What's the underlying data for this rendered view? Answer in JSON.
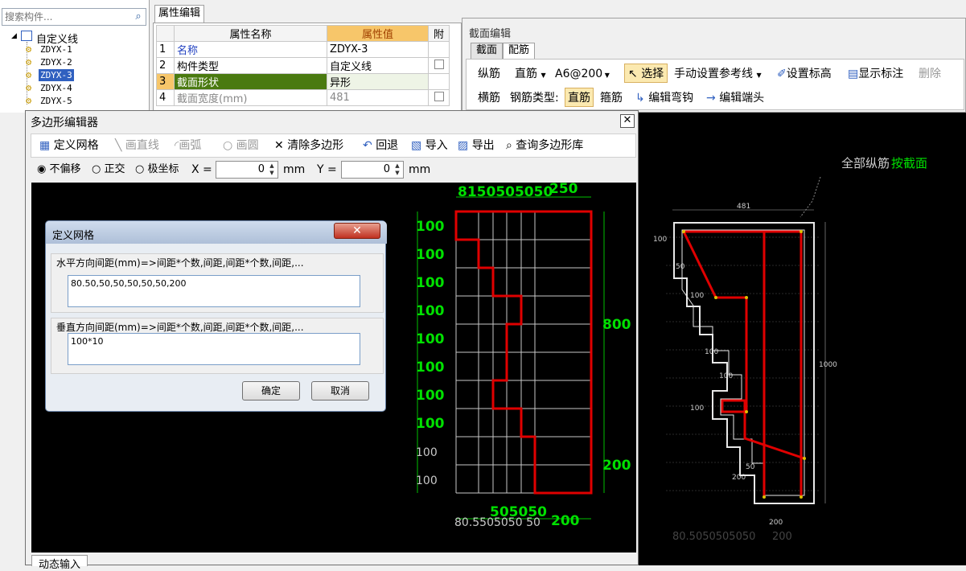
{
  "tree": {
    "search_placeholder": "搜索构件...",
    "root_label": "自定义线",
    "items": [
      "ZDYX-1",
      "ZDYX-2",
      "ZDYX-3",
      "ZDYX-4",
      "ZDYX-5"
    ]
  },
  "props": {
    "tab": "属性编辑",
    "headers": {
      "name": "属性名称",
      "value": "属性值",
      "attach": "附"
    },
    "rows": [
      {
        "no": "1",
        "name": "名称",
        "value": "ZDYX-3"
      },
      {
        "no": "2",
        "name": "构件类型",
        "value": "自定义线"
      },
      {
        "no": "3",
        "name": "截面形状",
        "value": "异形"
      },
      {
        "no": "4",
        "name": "截面宽度(mm)",
        "value": "481"
      }
    ]
  },
  "section": {
    "title": "截面编辑",
    "tabs": [
      "截面",
      "配筋"
    ],
    "row1": {
      "longbar": "纵筋",
      "type": "直筋",
      "spec": "A6@200",
      "select": "选择",
      "manual_ref": "手动设置参考线",
      "set_elev": "设置标高",
      "show_mark": "显示标注",
      "delete": "删除"
    },
    "row2": {
      "hbar": "横筋",
      "bar_type": "钢筋类型:",
      "straight": "直筋",
      "stirrup": "箍筋",
      "edit_hook": "编辑弯钩",
      "edit_end": "编辑端头"
    },
    "canvas_label": "全部纵筋",
    "canvas_label_green": "按截面",
    "dims": {
      "top": "481",
      "right": "1000",
      "bottom": "200",
      "left_top": "100",
      "bottom_x": "80.5050505050",
      "bottom_x2": "200",
      "mids": [
        "50",
        "100",
        "100",
        "100",
        "50",
        "200",
        "100"
      ]
    }
  },
  "poly": {
    "title": "多边形编辑器",
    "toolbar": {
      "define_grid": "定义网格",
      "draw_line": "画直线",
      "draw_arc": "画弧",
      "draw_circle": "画圆",
      "clear": "清除多边形",
      "undo": "回退",
      "import": "导入",
      "export": "导出",
      "query": "查询多边形库"
    },
    "modes": {
      "no_offset": "不偏移",
      "ortho": "正交",
      "polar": "极坐标"
    },
    "x_label": "X =",
    "x_value": "0",
    "y_label": "Y =",
    "y_value": "0",
    "unit": "mm",
    "dyn_tab": "动态输入",
    "dims": {
      "top_small": "8150505050",
      "top_big": "250",
      "left_rows": "100",
      "right_top": "800",
      "right_bottom": "200",
      "bottom_small": "80.5505050 50",
      "bottom_mid": "505050",
      "bottom_big": "200"
    }
  },
  "grid_dialog": {
    "title": "定义网格",
    "h_label": "水平方向间距(mm)=>间距*个数,间距,间距*个数,间距,...",
    "h_value": "80.50,50,50,50,50,50,200",
    "v_label": "垂直方向间距(mm)=>间距*个数,间距,间距*个数,间距,...",
    "v_value": "100*10",
    "ok": "确定",
    "cancel": "取消"
  },
  "colors": {
    "red": "#e00000",
    "green": "#00e000",
    "select": "#3060c0"
  }
}
